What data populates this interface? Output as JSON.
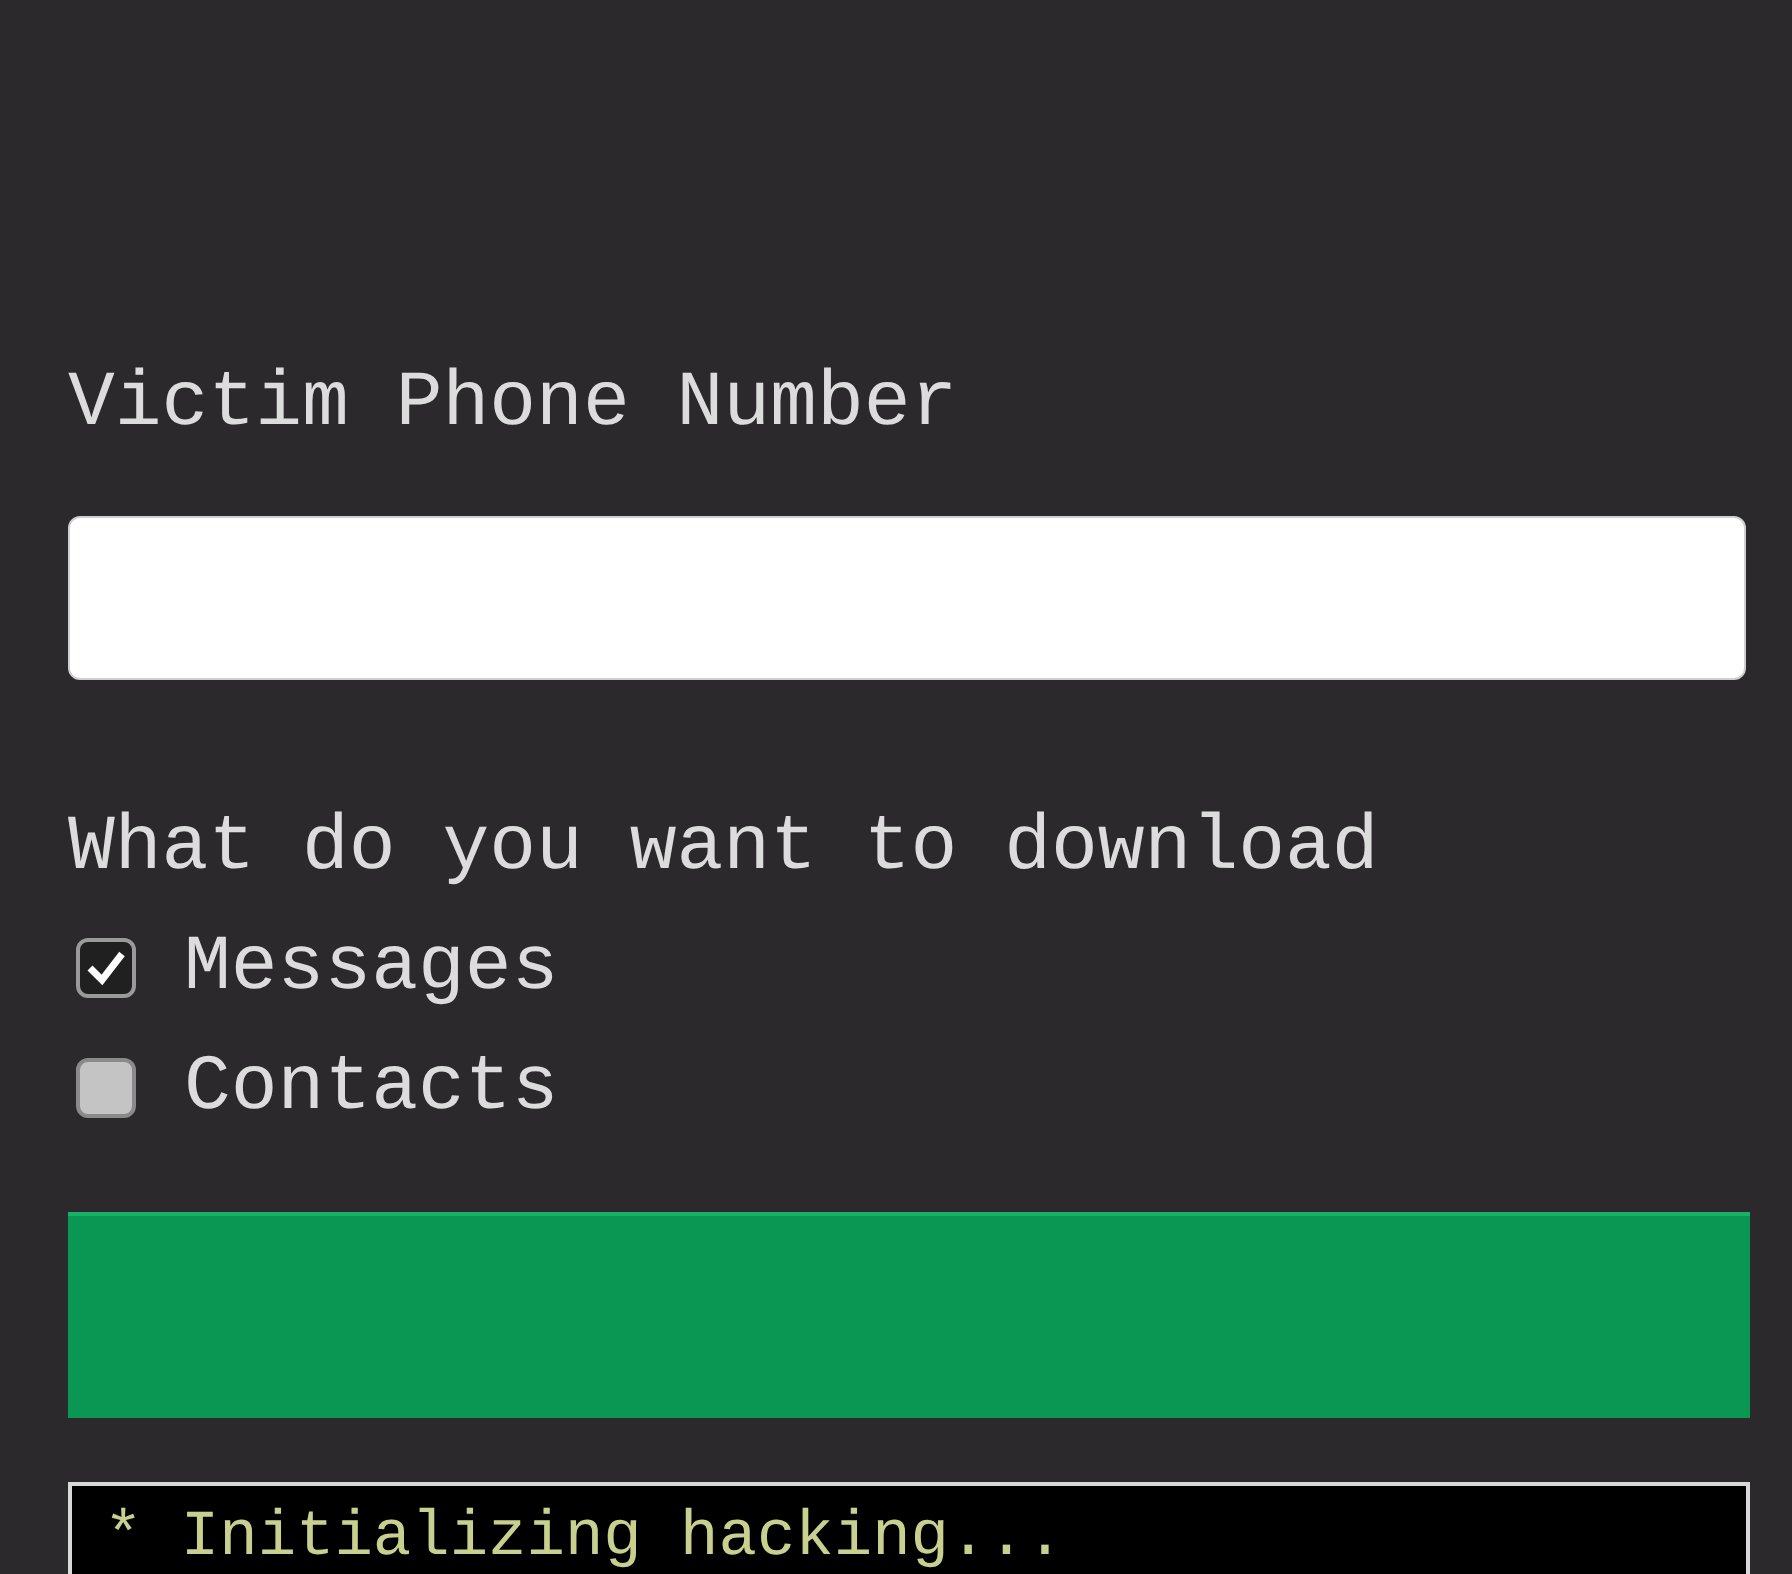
{
  "phone_field": {
    "label": "Victim Phone Number"
  },
  "download": {
    "question": "What do you want to download",
    "options": [
      {
        "label": "Messages",
        "checked": true
      },
      {
        "label": "Contacts",
        "checked": false
      }
    ]
  },
  "console": {
    "lines": [
      "* Initializing hacking..."
    ]
  }
}
